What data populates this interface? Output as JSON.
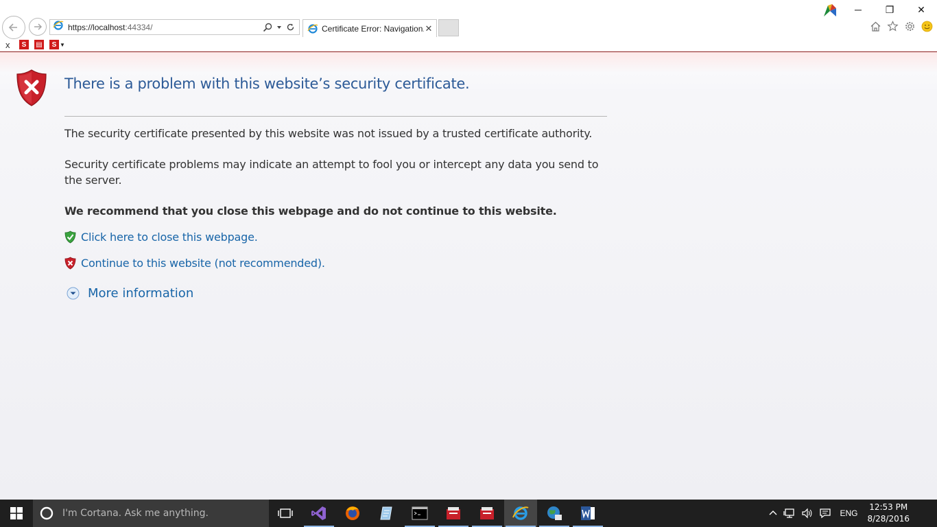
{
  "browser": {
    "address": {
      "prefix": "https://",
      "host": "localhost",
      "rest": ":44334/"
    },
    "tab": {
      "title": "Certificate Error: Navigation..."
    },
    "command_bar": {
      "close_label": "x"
    },
    "window_controls": {
      "minimize": "─",
      "restore": "❐",
      "close": "✕"
    }
  },
  "page": {
    "title": "There is a problem with this website’s security certificate.",
    "paragraph1": "The security certificate presented by this website was not issued by a trusted certificate authority.",
    "paragraph2": "Security certificate problems may indicate an attempt to fool you or intercept any data you send to the server.",
    "recommendation": "We recommend that you close this webpage and do not continue to this website.",
    "close_link": "Click here to close this webpage.",
    "continue_link": "Continue to this website (not recommended).",
    "more_info": "More information"
  },
  "taskbar": {
    "cortana_placeholder": "I'm Cortana. Ask me anything.",
    "language": "ENG",
    "time": "12:53 PM",
    "date": "8/28/2016",
    "apps": [
      "task-view",
      "visual-studio",
      "firefox",
      "notepad-app",
      "command-prompt",
      "app-red-1",
      "app-red-2",
      "internet-explorer",
      "network-app",
      "word"
    ]
  },
  "colors": {
    "title_blue": "#2c5a97",
    "link_blue": "#1865a8",
    "shield_red": "#c8202a",
    "shield_green": "#3aa33f",
    "taskbar": "#1f1f1f"
  }
}
